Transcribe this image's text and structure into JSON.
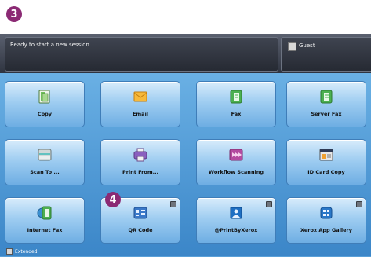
{
  "markers": {
    "step3": "3",
    "step4": "4"
  },
  "status": {
    "message": "Ready to start a new session.",
    "user": "Guest"
  },
  "apps": [
    {
      "label": "Copy",
      "icon": "copy-icon"
    },
    {
      "label": "Email",
      "icon": "email-icon"
    },
    {
      "label": "Fax",
      "icon": "fax-icon"
    },
    {
      "label": "Server Fax",
      "icon": "server-fax-icon"
    },
    {
      "label": "Scan To ...",
      "icon": "scan-to-icon"
    },
    {
      "label": "Print From...",
      "icon": "print-from-icon"
    },
    {
      "label": "Workflow Scanning",
      "icon": "workflow-scanning-icon"
    },
    {
      "label": "ID Card Copy",
      "icon": "id-card-copy-icon"
    },
    {
      "label": "Internet Fax",
      "icon": "internet-fax-icon"
    },
    {
      "label": "QR Code",
      "icon": "qr-code-icon"
    },
    {
      "label": "@PrintByXerox",
      "icon": "print-by-xerox-icon"
    },
    {
      "label": "Xerox App Gallery",
      "icon": "app-gallery-icon"
    }
  ],
  "footer": {
    "extended": "Extended"
  },
  "colors": {
    "badge": "#8b2a74",
    "tile_border": "#3f7db8",
    "panel": "#5aa0d8"
  }
}
